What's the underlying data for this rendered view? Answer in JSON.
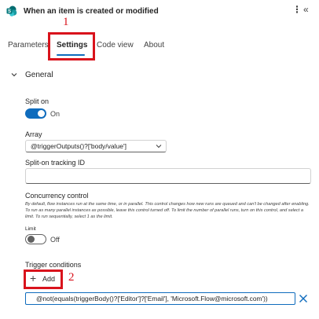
{
  "header": {
    "title": "When an item is created or modified",
    "more_icon": "more-vertical-icon",
    "collapse_icon": "double-chevron-left-icon",
    "logo_icon": "sharepoint-logo-icon"
  },
  "tabs": [
    {
      "label": "Parameters",
      "active": false
    },
    {
      "label": "Settings",
      "active": true
    },
    {
      "label": "Code view",
      "active": false
    },
    {
      "label": "About",
      "active": false
    }
  ],
  "annotations": {
    "one": "1",
    "two": "2",
    "color": "#d9131c"
  },
  "section": {
    "label": "General",
    "expanded": true
  },
  "split_on": {
    "label": "Split on",
    "state": "On"
  },
  "array": {
    "label": "Array",
    "value": "@triggerOutputs()?['body/value']"
  },
  "tracking": {
    "label": "Split-on tracking ID",
    "value": ""
  },
  "concurrency": {
    "label": "Concurrency control",
    "description": "By default, flow instances run at the same time, or in parallel. This control changes how new runs are queued and can't be changed after enabling. To run as many parallel instances as possible, leave this control turned off. To limit the number of parallel runs, turn on this control, and select a limit. To run sequentially, select 1 as the limit.",
    "limit_label": "Limit",
    "state": "Off"
  },
  "trigger_conditions": {
    "label": "Trigger conditions",
    "add_label": "Add",
    "value": "@not(equals(triggerBody()?['Editor']?['Email'], 'Microsoft.Flow@microsoft.com'))"
  },
  "colors": {
    "accent": "#0f6cbd",
    "text": "#242424"
  }
}
